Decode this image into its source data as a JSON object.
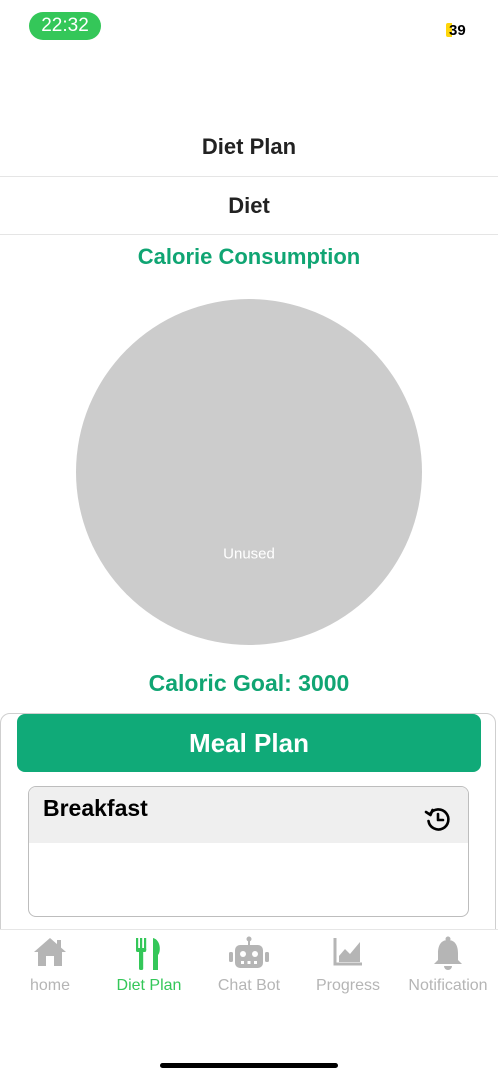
{
  "status_bar": {
    "time": "22:32",
    "battery": "39"
  },
  "header": {
    "title": "Diet Plan"
  },
  "tabs": {
    "active": "Diet"
  },
  "calorie": {
    "title": "Calorie Consumption",
    "goal_text": "Caloric Goal: 3000"
  },
  "chart_data": {
    "type": "pie",
    "categories": [
      "Unused"
    ],
    "values": [
      1
    ],
    "colors": [
      "#cccccc"
    ]
  },
  "meal_plan": {
    "button_label": "Meal Plan",
    "sections": [
      {
        "label": "Breakfast",
        "icon": "clock-refresh-icon"
      }
    ]
  },
  "tabbar": {
    "items": [
      {
        "label": "home",
        "icon": "home-icon",
        "active": false
      },
      {
        "label": "Diet Plan",
        "icon": "fork-knife-icon",
        "active": true
      },
      {
        "label": "Chat Bot",
        "icon": "robot-icon",
        "active": false
      },
      {
        "label": "Progress",
        "icon": "chart-icon",
        "active": false
      },
      {
        "label": "Notification",
        "icon": "bell-icon",
        "active": false
      }
    ]
  },
  "colors": {
    "accent": "#10a573",
    "active_tab": "#34c759",
    "inactive_tab": "#b5b5b5",
    "pie_unused": "#cccccc"
  }
}
